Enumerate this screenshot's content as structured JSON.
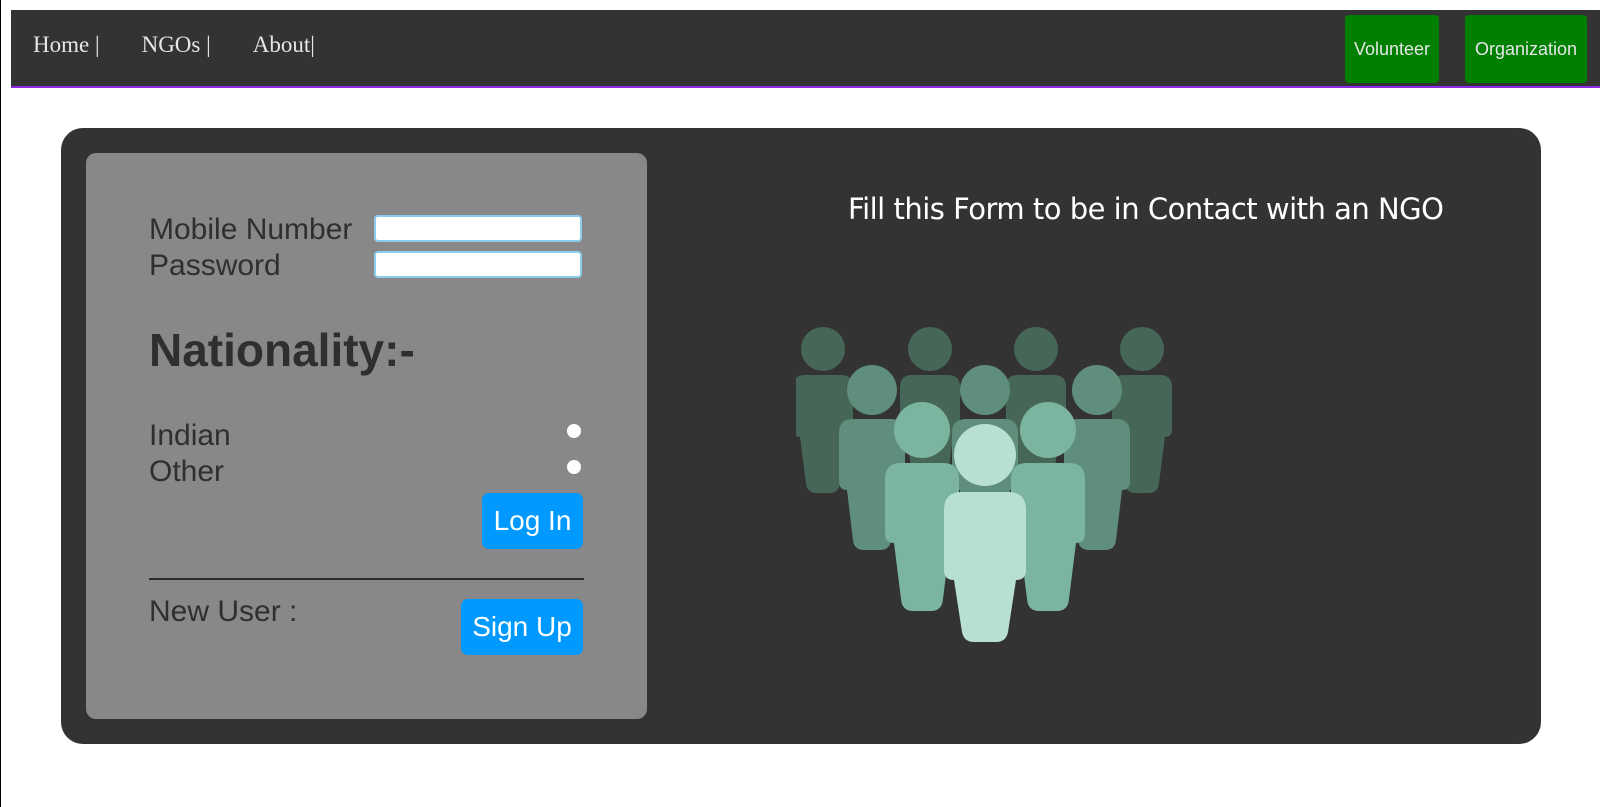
{
  "nav": {
    "links": [
      "Home |",
      "NGOs |",
      "About|"
    ],
    "buttons": {
      "volunteer": "Volunteer",
      "organization": "Organization"
    }
  },
  "form": {
    "mobile_label": "Mobile Number",
    "password_label": "Password",
    "mobile_value": "",
    "password_value": "",
    "nationality_heading": "Nationality:-",
    "options": [
      "Indian",
      "Other"
    ],
    "login_button": "Log In",
    "new_user_label": "New User :",
    "signup_button": "Sign Up"
  },
  "info": {
    "heading": "Fill this Form to be in Contact with an NGO",
    "illustration": "people-group-icon"
  },
  "colors": {
    "nav_bg": "#333333",
    "nav_accent": "#8a2be2",
    "nav_button": "#008000",
    "card_bg": "#333333",
    "form_bg": "#888888",
    "primary_button": "#0099ff"
  }
}
